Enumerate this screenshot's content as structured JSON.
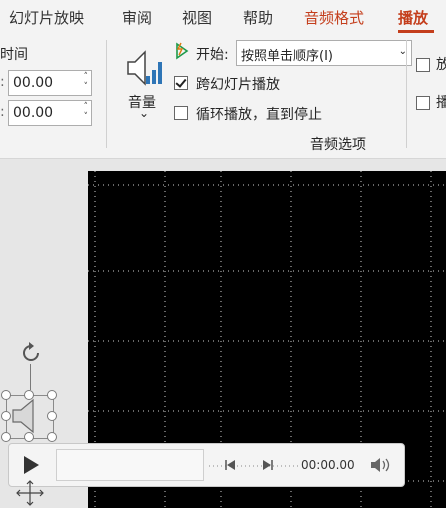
{
  "tabs": [
    "幻灯片放映",
    "审阅",
    "视图",
    "帮助",
    "音频格式",
    "播放"
  ],
  "timing": {
    "group_label": "时间",
    "fade_in": "00.00",
    "fade_out": "00.00"
  },
  "volume": {
    "label": "音量",
    "caret": "⌄"
  },
  "audio_options": {
    "start_label": "开始:",
    "start_value": "按照单击顺序(I)",
    "play_across_slides": {
      "label": "跨幻灯片播放",
      "checked": true
    },
    "loop_until_stopped": {
      "label": "循环播放，直到停止",
      "checked": false
    },
    "group_label": "音频选项",
    "extra_1": "放",
    "extra_2": "播"
  },
  "player": {
    "time": "00:00.00"
  },
  "colors": {
    "accent": "#c43e1c",
    "ribbon_bg": "#f3f3f3",
    "slide_bg": "#000000",
    "chart_blue": "#2e75b6"
  }
}
